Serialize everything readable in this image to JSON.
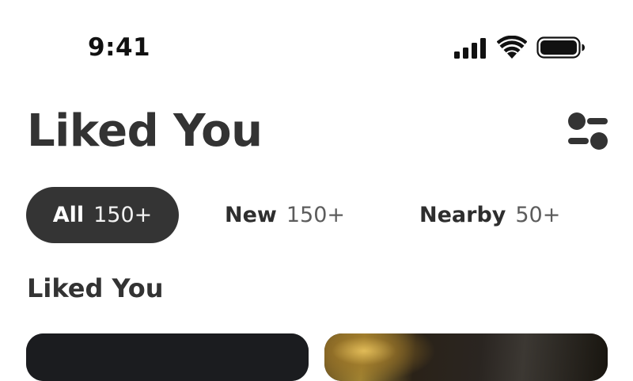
{
  "status_bar": {
    "time": "9:41",
    "icons": [
      "signal-icon",
      "wifi-icon",
      "battery-icon"
    ]
  },
  "header": {
    "title": "Liked You",
    "filter_icon": "filter-icon"
  },
  "tabs": [
    {
      "label": "All",
      "count": "150+",
      "selected": true
    },
    {
      "label": "New",
      "count": "150+",
      "selected": false
    },
    {
      "label": "Nearby",
      "count": "50+",
      "selected": false
    }
  ],
  "section": {
    "heading": "Liked You"
  },
  "colors": {
    "selected_tab_bg": "#343434",
    "text_primary": "#333333",
    "text_secondary": "#5c5c5c"
  }
}
